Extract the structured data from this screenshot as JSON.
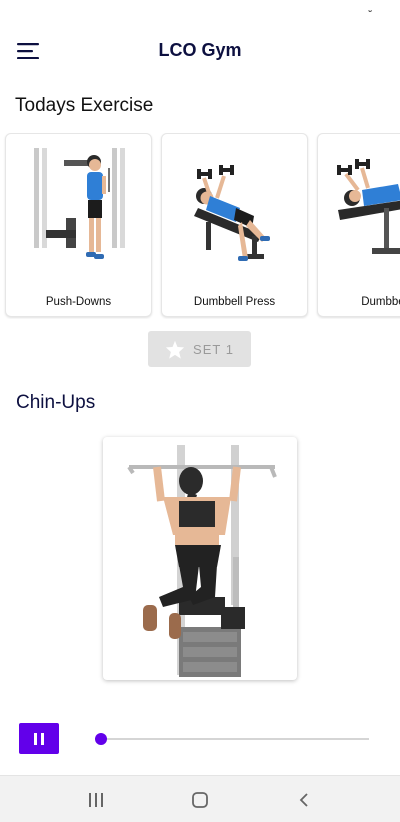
{
  "status_bar": {
    "glyph": "ᵕ"
  },
  "app_bar": {
    "title": "LCO Gym",
    "menu_icon": "hamburger-menu-icon"
  },
  "todays_exercise": {
    "heading": "Todays Exercise",
    "cards": [
      {
        "label": "Push-Downs",
        "image": "triceps-pushdown-illustration"
      },
      {
        "label": "Dumbbell Press",
        "image": "incline-dumbbell-press-illustration"
      },
      {
        "label": "Dumbbell T",
        "image": "dumbbell-fly-illustration"
      }
    ]
  },
  "set_button": {
    "label": "SET 1",
    "icon": "star-icon",
    "enabled": false
  },
  "current_exercise": {
    "title": "Chin-Ups",
    "image": "chin-ups-illustration"
  },
  "player": {
    "pause_icon": "pause-icon",
    "progress": 0.02,
    "accent": "#6200ea"
  },
  "nav_bar": {
    "recents_icon": "recents-icon",
    "home_icon": "home-icon",
    "back_icon": "back-icon"
  }
}
